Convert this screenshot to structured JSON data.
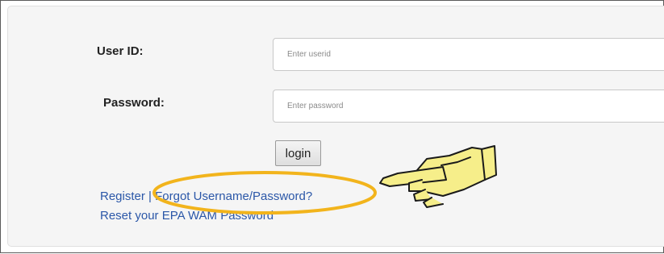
{
  "form": {
    "user_id_label": "User ID:",
    "user_id_placeholder": "Enter userid",
    "password_label": "Password:",
    "password_placeholder": "Enter password",
    "login_label": "login"
  },
  "links": {
    "register": "Register",
    "separator": "|",
    "forgot": "Forgot Username/Password?",
    "reset": "Reset your EPA WAM Password"
  },
  "annotation": {
    "highlight_color": "#f2b41c",
    "pointer_icon": "pointing-hand-icon",
    "pointer_fill": "#f6ee8a"
  }
}
